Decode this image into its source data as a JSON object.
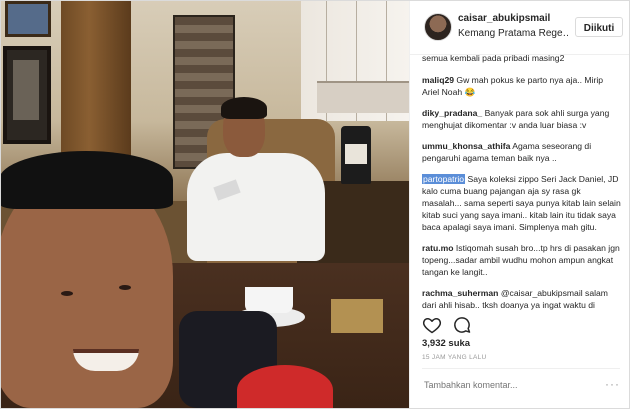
{
  "post": {
    "username": "caisar_abukipsmail",
    "location": "Kemang Pratama Rege…",
    "follow_label": "Diikuti"
  },
  "comments": {
    "partial_first": "semua kembali pada pribadi masing2",
    "items": [
      {
        "user": "maliq29",
        "text": "Gw mah pokus ke parto nya aja.. Mirip Ariel Noah 😂"
      },
      {
        "user": "diky_pradana_",
        "text": "Banyak para sok ahli surga yang menghujat dikomentar :v anda luar biasa :v"
      },
      {
        "user": "ummu_khonsa_athifa",
        "text": "Agama seseorang di pengaruhi agama teman baik nya .."
      },
      {
        "user": "partopatrio",
        "text": "Saya koleksi zippo Seri Jack Daniel, JD kalo cuma buang pajangan aja sy rasa gk masalah... sama seperti saya punya kitab lain selain kitab suci yang saya imani.. kitab lain itu tidak saya baca apalagi saya imani. Simplenya mah gitu."
      },
      {
        "user": "ratu.mo",
        "text": "Istiqomah susah bro...tp hrs di pasakan jgn topeng...sadar ambil wudhu mohon ampun angkat tangan ke langit.."
      },
      {
        "user": "rachma_suherman",
        "text": "@caisar_abukipsmail salam dari ahli hisab.. tksh doanya ya ingat waktu di mekkah suruh berdoa aja biar"
      }
    ]
  },
  "actions": {
    "like_icon": "heart-icon",
    "comment_icon": "comment-bubble-icon"
  },
  "likes": "3,932 suka",
  "timestamp": "15 JAM YANG LALU",
  "add_comment": {
    "placeholder": "Tambahkan komentar...",
    "more": "···"
  }
}
